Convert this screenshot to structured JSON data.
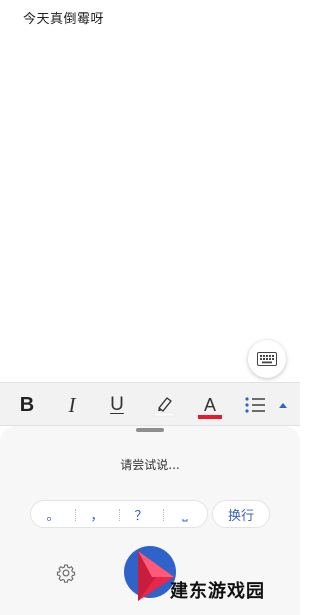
{
  "document": {
    "text": "今天真倒霉呀"
  },
  "keyboard_toggle": {
    "icon": "keyboard-icon"
  },
  "toolbar": {
    "bold_label": "B",
    "italic_label": "I",
    "underline_label": "U",
    "font_color_label": "A",
    "font_color": "#e8192c",
    "icons": [
      "highlighter-icon",
      "list-icon",
      "collapse-up-icon"
    ]
  },
  "voice_panel": {
    "prompt": "请尝试说...",
    "punctuation": [
      "。",
      "，",
      "？",
      "⎵"
    ],
    "newline_label": "换行",
    "settings_icon": "gear-icon",
    "mic_color": "#2f63c9"
  },
  "watermark": {
    "text": "建东游戏园"
  }
}
